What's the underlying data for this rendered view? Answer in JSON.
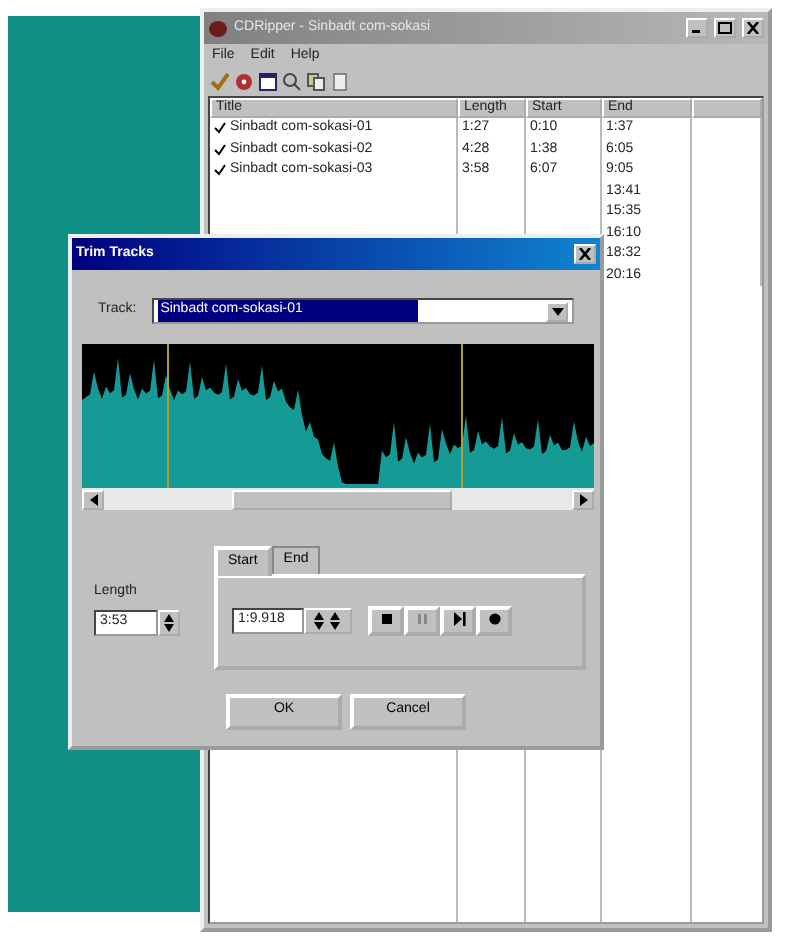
{
  "main_window": {
    "title": "CDRipper - Sinbadt com-sokasi",
    "menu": [
      "File",
      "Edit",
      "Help"
    ],
    "columns": [
      "Title",
      "Length",
      "Start",
      "End"
    ],
    "rows": [
      {
        "checked": true,
        "title": "Sinbadt com-sokasi-01",
        "length": "1:27",
        "start": "0:10",
        "end": "1:37"
      },
      {
        "checked": true,
        "title": "Sinbadt com-sokasi-02",
        "length": "4:28",
        "start": "1:38",
        "end": "6:05"
      },
      {
        "checked": true,
        "title": "Sinbadt com-sokasi-03",
        "length": "3:58",
        "start": "6:07",
        "end": "9:05"
      },
      {
        "end": "13:41"
      },
      {
        "end": "15:35"
      },
      {
        "end": "16:10"
      },
      {
        "end": "18:32"
      },
      {
        "end": "20:16"
      }
    ]
  },
  "dialog": {
    "title": "Trim Tracks",
    "track_label": "Track:",
    "track_value": "Sinbadt com-sokasi-01",
    "length_label": "Length",
    "length_value": "3:53",
    "tabs": [
      {
        "label": "Start",
        "selected": true
      },
      {
        "label": "End",
        "selected": false
      }
    ],
    "time_value": "1:9.918",
    "buttons": [
      "OK",
      "Cancel"
    ]
  }
}
